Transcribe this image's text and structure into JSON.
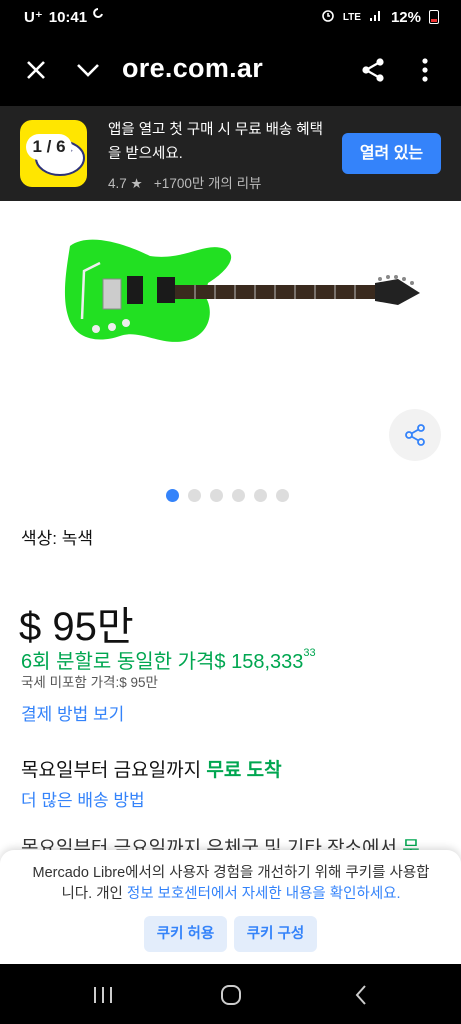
{
  "status_bar": {
    "carrier": "U⁺",
    "time": "10:41",
    "lte": "LTE",
    "battery": "12%"
  },
  "browser": {
    "url": "ore.com.ar",
    "icons": [
      "close-icon",
      "chevron-down-icon",
      "share-icon",
      "more-vert-icon"
    ]
  },
  "app_banner": {
    "logo_count": "1 / 6",
    "title": "앱을 열고 첫 구매 시 무료 배송 혜택을 받으세요.",
    "rating": "4.7",
    "reviews": "+1700만 개의 리뷰",
    "open_button": "열려 있는"
  },
  "gallery": {
    "active_index": 0,
    "total": 6
  },
  "product": {
    "color_label": "색상: 녹색",
    "price": "$ 95만",
    "installments": "6회 분할로 동일한 가격$ 158,333",
    "installments_cents": "33",
    "tax_note": "국세 미포함 가격:$ 95만",
    "payment_methods": "결제 방법 보기"
  },
  "shipping": {
    "text": "목요일부터 금요일까지",
    "free": "무료 도착",
    "more": "더 많은 배송 방법",
    "pickup": "목요일부터 금요일까지 우체국 및 기타 장소에서",
    "pickup_free": "무"
  },
  "cookie_notice": {
    "message_start": "Mercado Libre에서의 사용자 경험을 개선하기 위해 쿠키를 사용합니다. 개인",
    "link": "정보 보호센터에서 자세한 내용을 확인하세요.",
    "accept": "쿠키 허용",
    "configure": "쿠키 구성"
  },
  "colors": {
    "accent": "#3483fa",
    "green": "#00a650",
    "guitar": "#22e022",
    "banner_bg": "#222222",
    "logo_yellow": "#ffe600"
  }
}
